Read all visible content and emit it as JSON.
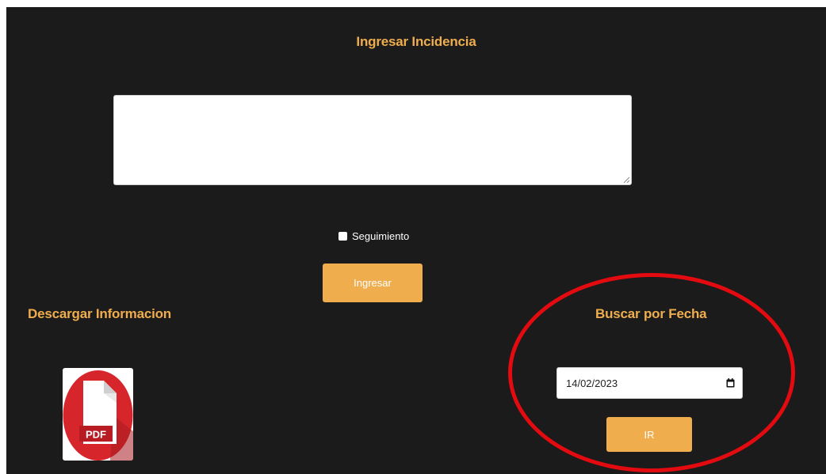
{
  "form": {
    "title": "Ingresar Incidencia",
    "textarea_value": "",
    "checkbox_label": "Seguimiento",
    "checkbox_checked": false,
    "submit_label": "Ingresar"
  },
  "download": {
    "title": "Descargar Informacion",
    "pdf_label": "PDF"
  },
  "search": {
    "title": "Buscar por Fecha",
    "date_value": "14/02/2023",
    "go_label": "IR"
  },
  "colors": {
    "background": "#1b1b1b",
    "accent": "#efad4e",
    "annotation": "#e30a10",
    "pdf_red": "#d6262b"
  },
  "icons": {
    "pdf": "pdf-file-icon",
    "calendar": "calendar-icon",
    "resize": "resize-grip-icon"
  }
}
